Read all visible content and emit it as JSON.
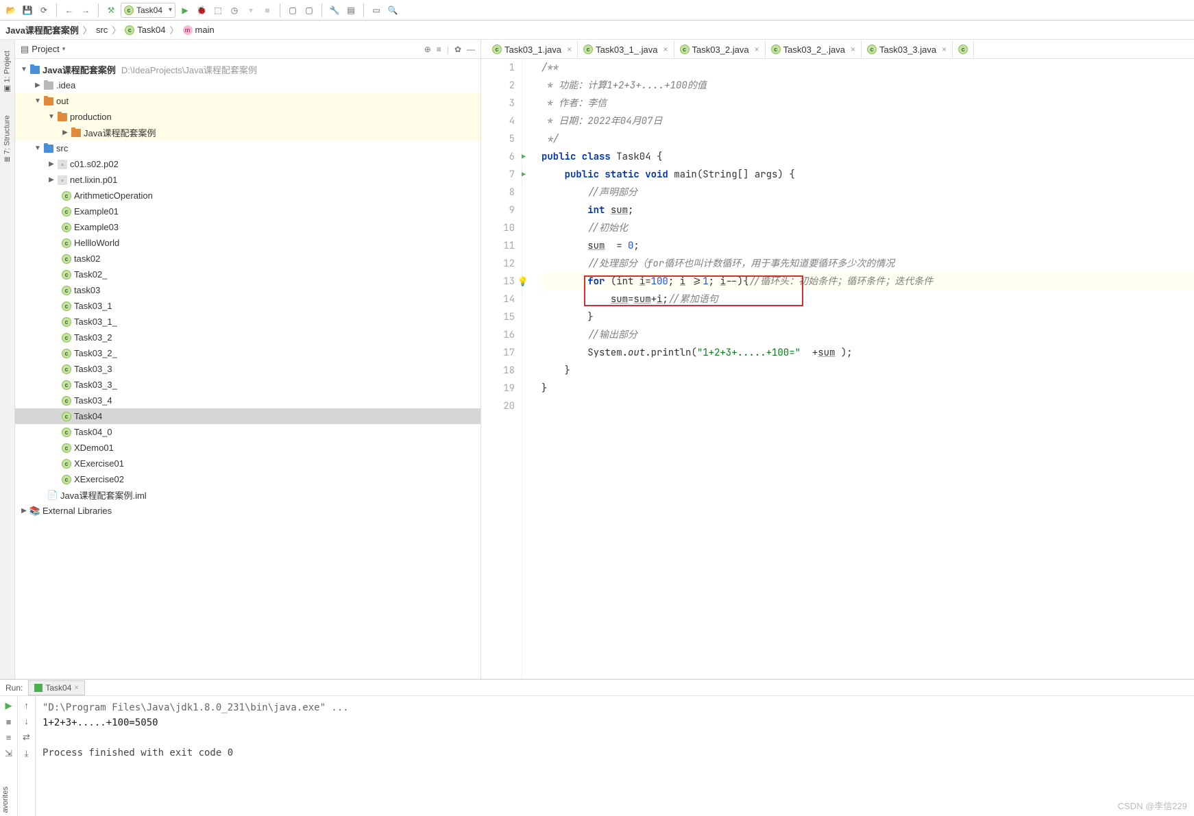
{
  "toolbar": {
    "run_config": "Task04"
  },
  "breadcrumb": {
    "project": "Java课程配套案例",
    "src": "src",
    "class": "Task04",
    "method": "main"
  },
  "side_tabs": {
    "project": "1: Project",
    "structure": "7: Structure"
  },
  "project_panel": {
    "title": "Project",
    "root_name": "Java课程配套案例",
    "root_path": "D:\\IdeaProjects\\Java课程配套案例",
    "idea_folder": ".idea",
    "out_folder": "out",
    "production_folder": "production",
    "production_child": "Java课程配套案例",
    "src_folder": "src",
    "pkg1": "c01.s02.p02",
    "pkg2": "net.lixin.p01",
    "files": [
      "ArithmeticOperation",
      "Example01",
      "Example03",
      "HellloWorld",
      "task02",
      "Task02_",
      "task03",
      "Task03_1",
      "Task03_1_",
      "Task03_2",
      "Task03_2_",
      "Task03_3",
      "Task03_3_",
      "Task03_4",
      "Task04",
      "Task04_0",
      "XDemo01",
      "XExercise01",
      "XExercise02"
    ],
    "iml": "Java课程配套案例.iml",
    "external": "External Libraries"
  },
  "editor": {
    "tabs": [
      "Task03_1.java",
      "Task03_1_.java",
      "Task03_2.java",
      "Task03_2_.java",
      "Task03_3.java"
    ],
    "lines": {
      "l1": "/**",
      "l2": " * 功能：计算1+2+3+....+100的值",
      "l3": " * 作者：李信",
      "l4": " * 日期：2022年04月07日",
      "l5": " */",
      "l6a": "public class ",
      "l6b": "Task04 {",
      "l7a": "    public static void ",
      "l7b": "main",
      "l7c": "(String[] args) {",
      "l8": "        //声明部分",
      "l9a": "        int ",
      "l9b": "sum",
      "l9c": ";",
      "l10": "        //初始化",
      "l11a": "        ",
      "l11b": "sum",
      "l11c": "  = ",
      "l11d": "0",
      "l11e": ";",
      "l12": "        //处理部分（for循环也叫计数循环，用于事先知道要循环多少次的情况",
      "l13a": "        for ",
      "l13b": "(int ",
      "l13c": "i",
      "l13d": "=",
      "l13e": "100",
      "l13f": "; ",
      "l13g": "i",
      "l13h": " >=",
      "l13i": "1",
      "l13j": "; ",
      "l13k": "i",
      "l13l": "--){",
      "l13m": "//循环头：初始条件；循环条件；迭代条件",
      "l14a": "            ",
      "l14b": "sum",
      "l14c": "=",
      "l14d": "sum",
      "l14e": "+",
      "l14f": "i",
      "l14g": ";",
      "l14h": "//累加语句",
      "l15": "        }",
      "l16": "        //输出部分",
      "l17a": "        System.",
      "l17b": "out",
      "l17c": ".println(",
      "l17d": "\"1+2+3+.....+100=\"",
      "l17e": "  +",
      "l17f": "sum",
      "l17g": " );",
      "l18": "    }",
      "l19": "}"
    }
  },
  "run": {
    "header": "Run:",
    "tab": "Task04",
    "cmd": "\"D:\\Program Files\\Java\\jdk1.8.0_231\\bin\\java.exe\" ...",
    "output": "1+2+3+.....+100=5050",
    "exit": "Process finished with exit code 0"
  },
  "watermark": "CSDN @李信229",
  "favorites": "avorites"
}
